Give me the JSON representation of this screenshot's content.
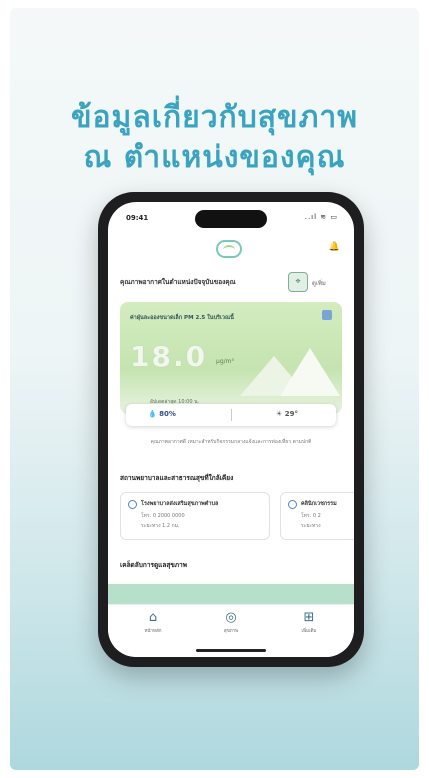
{
  "headline": {
    "line1": "ข้อมูลเกี่ยวกับสุขภาพ",
    "line2": "ณ ตำแหน่งของคุณ"
  },
  "status_bar": {
    "time": "09:41",
    "icons": "..ıl ≋ ▭"
  },
  "header": {
    "logo_icon": "leaf-circle-logo-icon",
    "bell_icon": "bell-icon",
    "bell_glyph": "🔔"
  },
  "location": {
    "label": "คุณภาพอากาศในตำแหน่งปัจจุบันของคุณ",
    "badge_icon": "map-pin-icon",
    "badge_glyph": "⌖",
    "more": "ดูเพิ่ม"
  },
  "air_quality": {
    "label": "ค่าฝุ่นละอองขนาดเล็ก PM 2.5 ในบริเวณนี้",
    "value": "18.0",
    "unit": "µg/m³",
    "note": "อัปเดตล่าสุด 10:00 น.",
    "status_color": "#c5e4b0"
  },
  "weather": {
    "humidity": "💧 80%",
    "temperature": "☀ 29°"
  },
  "advice": "คุณภาพอากาศดี เหมาะสำหรับกิจกรรมกลางแจ้งและการท่องเที่ยว ตามปกติ",
  "hospitals": {
    "title": "สถานพยาบาลและสาธารณสุขที่ใกล้เคียง",
    "items": [
      {
        "name": "โรงพยาบาลส่งเสริมสุขภาพตำบล",
        "line1": "โทร. 0 2000 0000",
        "line2": "ระยะทาง 1.2 กม."
      },
      {
        "name": "คลินิกเวชกรรม",
        "line1": "โทร. 0 2",
        "line2": "ระยะทาง"
      }
    ]
  },
  "tips": {
    "title": "เคล็ดลับการดูแลสุขภาพ"
  },
  "tabbar": {
    "items": [
      {
        "label": "หน้าหลัก",
        "icon": "home-icon",
        "glyph": "⌂"
      },
      {
        "label": "สุขภาพ",
        "icon": "heart-pulse-icon",
        "glyph": "◎"
      },
      {
        "label": "เพิ่มเติม",
        "icon": "grid-menu-icon",
        "glyph": "⊞"
      }
    ]
  }
}
